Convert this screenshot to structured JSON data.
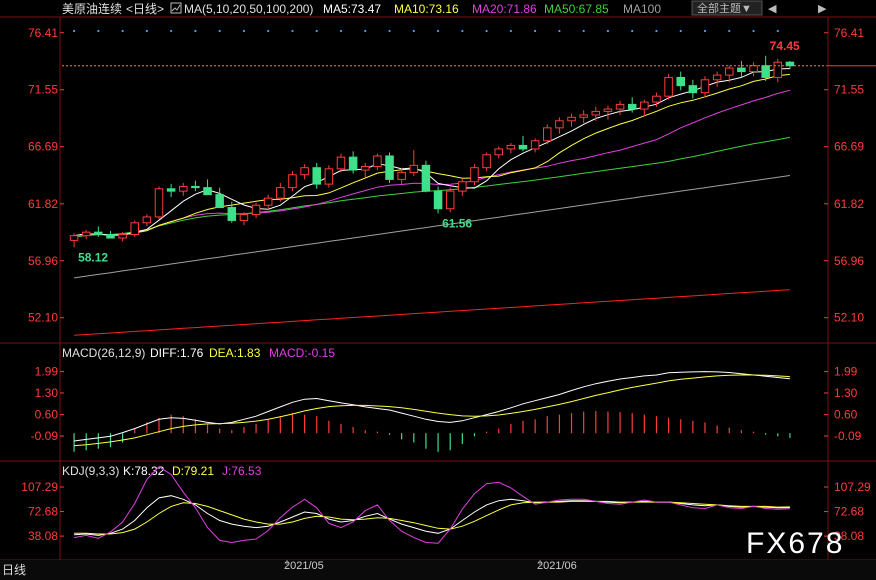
{
  "header": {
    "title": "美原油连续",
    "period": "<日线>",
    "ma_params": "MA(5,10,20,50,100,200)",
    "ma5": "MA5:73.47",
    "ma10": "MA10:73.16",
    "ma20": "MA20:71.86",
    "ma50": "MA50:67.85",
    "ma100": "MA100",
    "theme_button": "全部主题▼",
    "nav_prev": "◀",
    "nav_next": "▶"
  },
  "macd_header": {
    "name": "MACD(26,12,9)",
    "diff": "DIFF:1.76",
    "dea": "DEA:1.83",
    "macd": "MACD:-0.15"
  },
  "kdj_header": {
    "name": "KDJ(9,3,3)",
    "k": "K:78.32",
    "d": "D:79.21",
    "j": "J:76.53"
  },
  "footer": {
    "tab": "日线",
    "date1": "2021/05",
    "date2": "2021/06",
    "watermark": "FX678"
  },
  "colors": {
    "up": "#ff3b3b",
    "down": "#3ee08a",
    "ma5": "#ffffff",
    "ma10": "#ffff40",
    "ma20": "#e040e0",
    "ma50": "#40d040",
    "ma100": "#a0a0a0",
    "ma200": "#ff2020",
    "axis": "#ff3b3b",
    "grid": "#7a1010"
  },
  "chart_data": [
    {
      "type": "candlestick",
      "panel": "price",
      "y_ticks": [
        "76.41",
        "71.55",
        "66.69",
        "61.82",
        "56.96",
        "52.10"
      ],
      "ylim": [
        50.2,
        77.5
      ],
      "annotations": [
        {
          "label": "74.45",
          "kind": "high",
          "index": 57
        },
        {
          "label": "61.56",
          "kind": "low",
          "index": 30
        },
        {
          "label": "58.12",
          "kind": "low",
          "index": 0
        }
      ],
      "last_price": 73.6,
      "candles": [
        [
          58.7,
          59.3,
          58.1,
          59.1
        ],
        [
          59.1,
          59.6,
          58.8,
          59.4
        ],
        [
          59.4,
          59.9,
          59.0,
          59.2
        ],
        [
          59.2,
          59.5,
          58.9,
          58.9
        ],
        [
          58.9,
          59.4,
          58.6,
          59.2
        ],
        [
          59.2,
          60.4,
          59.0,
          60.2
        ],
        [
          60.2,
          60.9,
          59.9,
          60.7
        ],
        [
          60.7,
          63.3,
          60.5,
          63.1
        ],
        [
          63.1,
          63.5,
          62.4,
          62.9
        ],
        [
          62.9,
          63.6,
          62.5,
          63.3
        ],
        [
          63.3,
          63.8,
          62.9,
          63.2
        ],
        [
          63.2,
          63.9,
          62.8,
          62.6
        ],
        [
          62.6,
          63.2,
          61.9,
          61.5
        ],
        [
          61.5,
          62.0,
          60.2,
          60.4
        ],
        [
          60.4,
          61.1,
          60.0,
          60.9
        ],
        [
          60.9,
          61.9,
          60.6,
          61.7
        ],
        [
          61.7,
          62.6,
          61.3,
          62.3
        ],
        [
          62.3,
          63.6,
          62.0,
          63.2
        ],
        [
          63.2,
          64.6,
          62.9,
          64.3
        ],
        [
          64.3,
          65.2,
          63.9,
          64.9
        ],
        [
          64.9,
          65.3,
          63.1,
          63.5
        ],
        [
          63.5,
          65.1,
          63.2,
          64.8
        ],
        [
          64.8,
          66.1,
          64.5,
          65.8
        ],
        [
          65.8,
          66.3,
          64.4,
          64.7
        ],
        [
          64.7,
          65.3,
          64.1,
          65.0
        ],
        [
          65.0,
          66.1,
          64.7,
          65.9
        ],
        [
          65.9,
          66.2,
          63.6,
          63.9
        ],
        [
          63.9,
          64.9,
          63.5,
          64.5
        ],
        [
          64.5,
          66.4,
          64.2,
          65.1
        ],
        [
          65.1,
          65.5,
          62.8,
          62.9
        ],
        [
          62.9,
          63.3,
          61.0,
          61.4
        ],
        [
          61.4,
          63.2,
          61.1,
          62.9
        ],
        [
          62.9,
          64.0,
          62.5,
          63.7
        ],
        [
          63.7,
          65.2,
          63.4,
          64.9
        ],
        [
          64.9,
          66.2,
          64.6,
          66.0
        ],
        [
          66.0,
          66.7,
          65.7,
          66.5
        ],
        [
          66.5,
          67.0,
          66.1,
          66.8
        ],
        [
          66.8,
          67.6,
          66.3,
          66.5
        ],
        [
          66.5,
          67.4,
          66.2,
          67.2
        ],
        [
          67.2,
          68.6,
          66.9,
          68.3
        ],
        [
          68.3,
          69.2,
          67.8,
          68.9
        ],
        [
          68.9,
          69.5,
          68.4,
          69.2
        ],
        [
          69.2,
          69.8,
          68.7,
          69.4
        ],
        [
          69.4,
          70.1,
          68.9,
          69.7
        ],
        [
          69.7,
          70.2,
          69.0,
          69.9
        ],
        [
          69.9,
          70.6,
          69.4,
          70.3
        ],
        [
          70.3,
          70.9,
          69.6,
          69.9
        ],
        [
          69.9,
          70.7,
          69.3,
          70.5
        ],
        [
          70.5,
          71.3,
          70.1,
          71.0
        ],
        [
          71.0,
          72.9,
          70.7,
          72.6
        ],
        [
          72.6,
          73.1,
          71.5,
          71.9
        ],
        [
          71.9,
          72.4,
          70.8,
          71.3
        ],
        [
          71.3,
          72.7,
          70.9,
          72.4
        ],
        [
          72.4,
          73.1,
          71.8,
          72.8
        ],
        [
          72.8,
          73.6,
          72.2,
          73.4
        ],
        [
          73.4,
          74.0,
          72.6,
          73.1
        ],
        [
          73.1,
          73.9,
          72.7,
          73.6
        ],
        [
          73.6,
          74.45,
          72.3,
          72.6
        ],
        [
          72.6,
          74.2,
          72.2,
          73.9
        ],
        [
          73.9,
          74.0,
          73.3,
          73.6
        ]
      ]
    },
    {
      "type": "line",
      "panel": "macd",
      "series": [
        {
          "name": "DIFF",
          "values": [
            -0.25,
            -0.2,
            -0.15,
            -0.1,
            0.02,
            0.15,
            0.3,
            0.45,
            0.5,
            0.48,
            0.42,
            0.35,
            0.3,
            0.35,
            0.45,
            0.55,
            0.7,
            0.85,
            1.0,
            1.1,
            1.12,
            1.05,
            0.98,
            0.92,
            0.85,
            0.8,
            0.75,
            0.65,
            0.55,
            0.45,
            0.38,
            0.35,
            0.4,
            0.5,
            0.6,
            0.7,
            0.82,
            0.95,
            1.05,
            1.15,
            1.25,
            1.38,
            1.5,
            1.6,
            1.68,
            1.75,
            1.8,
            1.85,
            1.88,
            1.95,
            1.97,
            1.98,
            1.99,
            1.98,
            1.96,
            1.92,
            1.88,
            1.84,
            1.8,
            1.76
          ]
        },
        {
          "name": "DEA",
          "values": [
            -0.4,
            -0.37,
            -0.33,
            -0.28,
            -0.22,
            -0.15,
            -0.05,
            0.05,
            0.15,
            0.22,
            0.27,
            0.3,
            0.31,
            0.32,
            0.35,
            0.39,
            0.45,
            0.53,
            0.62,
            0.72,
            0.8,
            0.86,
            0.89,
            0.9,
            0.9,
            0.88,
            0.86,
            0.82,
            0.77,
            0.71,
            0.65,
            0.6,
            0.56,
            0.55,
            0.56,
            0.59,
            0.64,
            0.7,
            0.77,
            0.85,
            0.93,
            1.02,
            1.12,
            1.22,
            1.31,
            1.4,
            1.48,
            1.55,
            1.62,
            1.69,
            1.74,
            1.78,
            1.82,
            1.85,
            1.87,
            1.88,
            1.88,
            1.87,
            1.85,
            1.83
          ]
        }
      ],
      "histogram": [
        -0.6,
        -0.55,
        -0.5,
        -0.45,
        -0.3,
        0.15,
        0.35,
        0.5,
        0.6,
        0.55,
        0.45,
        0.3,
        0.15,
        0.1,
        0.2,
        0.3,
        0.45,
        0.55,
        0.65,
        0.6,
        0.55,
        0.4,
        0.3,
        0.2,
        0.1,
        0.05,
        -0.05,
        -0.2,
        -0.3,
        -0.5,
        -0.6,
        -0.55,
        -0.35,
        -0.1,
        0.05,
        0.15,
        0.3,
        0.4,
        0.45,
        0.55,
        0.6,
        0.65,
        0.7,
        0.72,
        0.7,
        0.68,
        0.65,
        0.6,
        0.55,
        0.5,
        0.45,
        0.4,
        0.35,
        0.25,
        0.18,
        0.1,
        0.05,
        -0.05,
        -0.1,
        -0.15
      ],
      "y_ticks": [
        "1.99",
        "1.30",
        "0.60",
        "-0.09"
      ],
      "ylim": [
        -0.8,
        2.3
      ]
    },
    {
      "type": "line",
      "panel": "kdj",
      "series": [
        {
          "name": "K",
          "values": [
            40,
            41,
            39,
            42,
            48,
            60,
            78,
            92,
            95,
            90,
            82,
            70,
            60,
            55,
            52,
            50,
            52,
            58,
            65,
            72,
            70,
            62,
            58,
            60,
            66,
            70,
            62,
            55,
            50,
            45,
            42,
            48,
            60,
            72,
            82,
            88,
            90,
            88,
            85,
            86,
            87,
            88,
            88,
            87,
            86,
            85,
            86,
            87,
            86,
            86,
            84,
            82,
            81,
            82,
            80,
            79,
            80,
            79,
            78,
            78.32
          ]
        },
        {
          "name": "D",
          "values": [
            42,
            42,
            41,
            41,
            43,
            48,
            58,
            70,
            80,
            85,
            84,
            80,
            74,
            68,
            62,
            58,
            55,
            55,
            58,
            63,
            66,
            65,
            62,
            61,
            62,
            64,
            63,
            60,
            57,
            53,
            49,
            48,
            52,
            59,
            67,
            75,
            82,
            85,
            86,
            86,
            86,
            87,
            87,
            87,
            87,
            86,
            86,
            86,
            86,
            86,
            85,
            84,
            83,
            82,
            81,
            80,
            80,
            80,
            79,
            79.21
          ]
        },
        {
          "name": "J",
          "values": [
            36,
            39,
            35,
            44,
            58,
            84,
            118,
            136,
            125,
            100,
            78,
            50,
            32,
            29,
            32,
            34,
            46,
            64,
            79,
            90,
            78,
            56,
            50,
            58,
            74,
            82,
            60,
            45,
            36,
            29,
            28,
            48,
            76,
            98,
            112,
            114,
            106,
            94,
            83,
            86,
            89,
            90,
            90,
            87,
            84,
            83,
            86,
            89,
            86,
            86,
            82,
            78,
            77,
            82,
            78,
            77,
            80,
            77,
            76,
            76.53
          ]
        }
      ],
      "y_ticks": [
        "107.29",
        "72.68",
        "38.08"
      ],
      "ylim": [
        10,
        120
      ]
    }
  ]
}
